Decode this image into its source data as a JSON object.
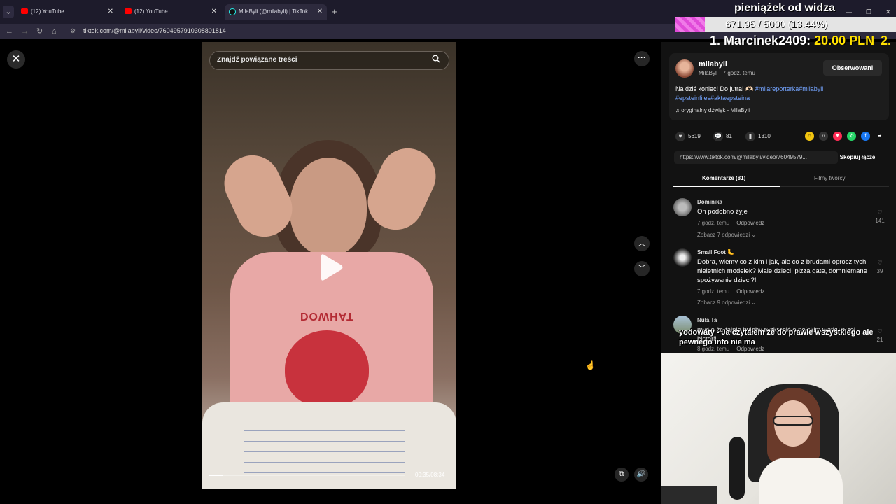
{
  "browser": {
    "tabs": [
      {
        "title": "(12) YouTube",
        "icon": "youtube-icon"
      },
      {
        "title": "(12) YouTube",
        "icon": "youtube-icon"
      },
      {
        "title": "MilaByli (@milabyli) | TikTok",
        "icon": "tiktok-icon"
      }
    ],
    "url": "tiktok.com/@milabyli/video/7604957910308801814"
  },
  "search": {
    "placeholder": "Znajdź powiązane treści"
  },
  "video": {
    "time": "00:35/08:34",
    "progress": 0.068,
    "shirt_print": "DOWHAT"
  },
  "post": {
    "username": "milabyli",
    "display": "MilaByli · 7 godz. temu",
    "follow_label": "Obserwowani",
    "desc_text": "Na dziś koniec! Do jutra! 🫶🏻 ",
    "tags_line1": "#milareporterka#milabyli",
    "tags_line2": "#epsteinfiles#aktaepsteina",
    "sound": "oryginalny dźwięk - MilaByli",
    "likes": "5619",
    "comments": "81",
    "saves": "1310",
    "link": "https://www.tiktok.com/@milabyli/video/76049579...",
    "copy_label": "Skopiuj łącze"
  },
  "tabs2": {
    "comments": "Komentarze (81)",
    "creator": "Filmy twórcy"
  },
  "comments": [
    {
      "name": "Dominika",
      "text": "On podobno żyje",
      "time": "7 godz. temu",
      "reply": "Odpowiedz",
      "more": "Zobacz 7 odpowiedzi ⌄",
      "likes": "141"
    },
    {
      "name": "Small Foot 🦶",
      "text": "Dobra, wiemy co z kim i jak, ale co z brudami oprocz tych nieletnich modelek? Male dzieci, pizza gate, domniemane spożywanie dzieci?!",
      "time": "7 godz. temu",
      "reply": "Odpowiedz",
      "more": "Zobacz 9 odpowiedzi ⌄",
      "likes": "39"
    },
    {
      "name": "Nula Ta",
      "text": "myśle że fajnie byłoby rozkręcić o polskim wątku w tej historii",
      "time": "8 godz. temu",
      "reply": "Odpowiedz",
      "likes": "21"
    }
  ],
  "chat": {
    "user": "yodowaty",
    "message": "yodowaty - Ja czytałem że do prawie wszystkiego ale pewnego info nie ma"
  },
  "donation": {
    "title": "pieniążek od widza",
    "amount": "671.95 / 5000 (13.44%)",
    "progress": 0.1344,
    "top_prefix": "1. Marcinek2409: ",
    "top_value": "20.00 PLN",
    "top2": "2."
  },
  "colors": {
    "accent_link": "#74a4ff",
    "donation_fill": "#e04bd8",
    "chat_user": "#f0a000"
  }
}
